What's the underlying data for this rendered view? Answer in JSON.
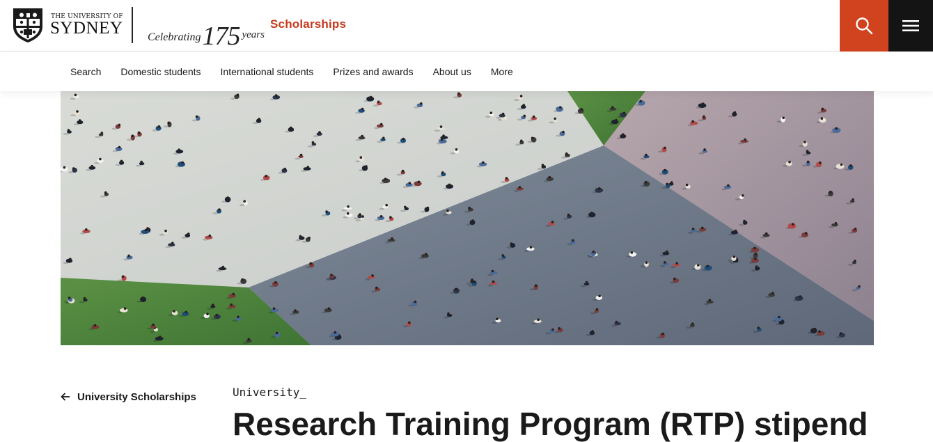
{
  "header": {
    "university_line1": "THE UNIVERSITY OF",
    "university_line2": "SYDNEY",
    "celebrating_word": "Celebrating",
    "celebrating_number": "175",
    "celebrating_unit": "years",
    "site_title": "Scholarships",
    "search_icon": "search-icon",
    "menu_icon": "hamburger-menu-icon",
    "accent_color": "#d1431e",
    "title_color": "#c7381c"
  },
  "nav": {
    "items": [
      {
        "label": "Search"
      },
      {
        "label": "Domestic students"
      },
      {
        "label": "International students"
      },
      {
        "label": "Prizes and awards"
      },
      {
        "label": "About us"
      },
      {
        "label": "More"
      }
    ]
  },
  "hero": {
    "image": "aerial-view-crowd-walking-plaza"
  },
  "content": {
    "back_link_label": "University Scholarships",
    "back_icon": "arrow-left-icon",
    "eyebrow": "University_",
    "title": "Research Training Program (RTP) stipend"
  }
}
